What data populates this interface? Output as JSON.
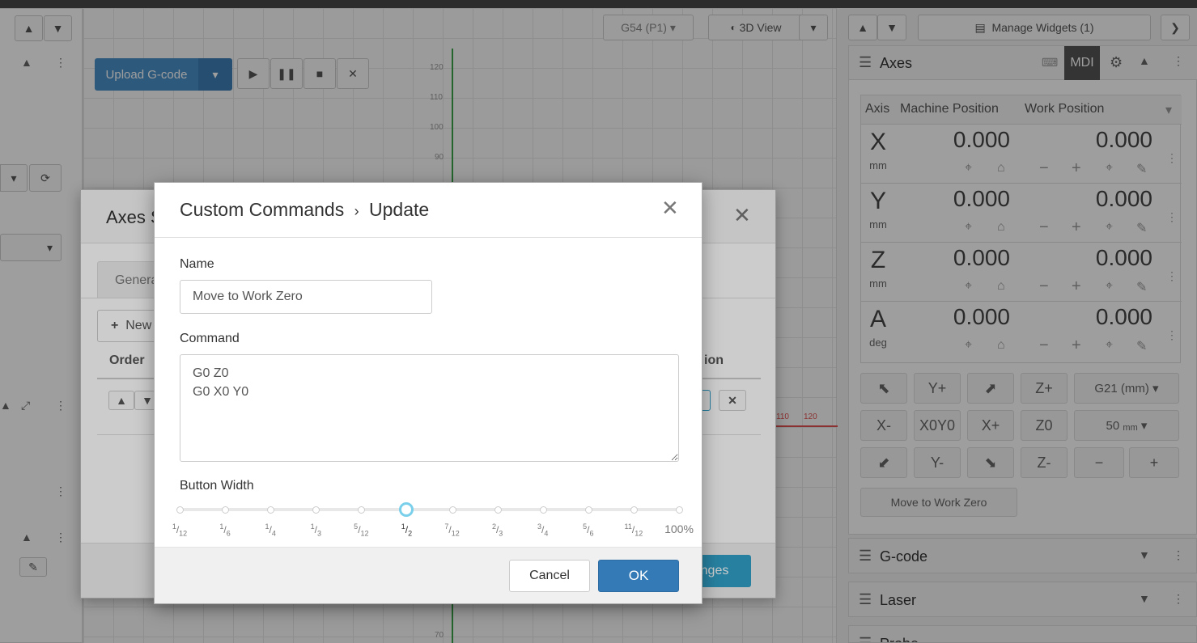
{
  "toolbar": {
    "upload_label": "Upload G-code",
    "wcs_label": "G54 (P1)",
    "view_label": "3D View",
    "manage_widgets_label": "Manage Widgets (1)"
  },
  "visualizer": {
    "y_ticks": [
      "120",
      "110",
      "100",
      "90",
      "70"
    ],
    "x_ticks": [
      "110",
      "120"
    ]
  },
  "axes_widget": {
    "title": "Axes",
    "mdi_label": "MDI",
    "col_axis": "Axis",
    "col_machine": "Machine Position",
    "col_work": "Work Position",
    "rows": [
      {
        "axis": "X",
        "unit": "mm",
        "machine": "0.000",
        "work": "0.000"
      },
      {
        "axis": "Y",
        "unit": "mm",
        "machine": "0.000",
        "work": "0.000"
      },
      {
        "axis": "Z",
        "unit": "mm",
        "machine": "0.000",
        "work": "0.000"
      },
      {
        "axis": "A",
        "unit": "deg",
        "machine": "0.000",
        "work": "0.000"
      }
    ],
    "jog": {
      "y_plus": "Y+",
      "z_plus": "Z+",
      "units_select": "G21 (mm)",
      "x_minus": "X-",
      "x0y0": "X0Y0",
      "x_plus": "X+",
      "z0": "Z0",
      "step_value": "50",
      "step_unit": "mm",
      "y_minus": "Y-",
      "z_minus": "Z-",
      "minus": "−",
      "plus": "+"
    },
    "custom_button_label": "Move to Work Zero"
  },
  "widgets": {
    "gcode_title": "G-code",
    "laser_title": "Laser",
    "probe_title": "Probe"
  },
  "settings_modal": {
    "title": "Axes S",
    "tab_general": "Genera",
    "new_button": "New",
    "col_order": "Order",
    "col_action": "ion",
    "save_label": "nges"
  },
  "dialog": {
    "title_left": "Custom Commands",
    "title_sep": "›",
    "title_right": "Update",
    "name_label": "Name",
    "name_value": "Move to Work Zero",
    "command_label": "Command",
    "command_value": "G0 Z0\nG0 X0 Y0",
    "width_label": "Button Width",
    "width_selected_index": 5,
    "width_ticks": [
      {
        "num": "1",
        "den": "12"
      },
      {
        "num": "1",
        "den": "6"
      },
      {
        "num": "1",
        "den": "4"
      },
      {
        "num": "1",
        "den": "3"
      },
      {
        "num": "5",
        "den": "12"
      },
      {
        "num": "1",
        "den": "2"
      },
      {
        "num": "7",
        "den": "12"
      },
      {
        "num": "2",
        "den": "3"
      },
      {
        "num": "3",
        "den": "4"
      },
      {
        "num": "5",
        "den": "6"
      },
      {
        "num": "11",
        "den": "12"
      },
      {
        "num": "",
        "den": "",
        "full": "100%"
      }
    ],
    "cancel_label": "Cancel",
    "ok_label": "OK"
  },
  "colors": {
    "primary": "#337ab7",
    "upload": "#4a90c8",
    "settings_save": "#31a0c8",
    "slider_handle": "#7ad0ea",
    "red_axis": "#e05050",
    "green_axis": "#3aa34a"
  }
}
